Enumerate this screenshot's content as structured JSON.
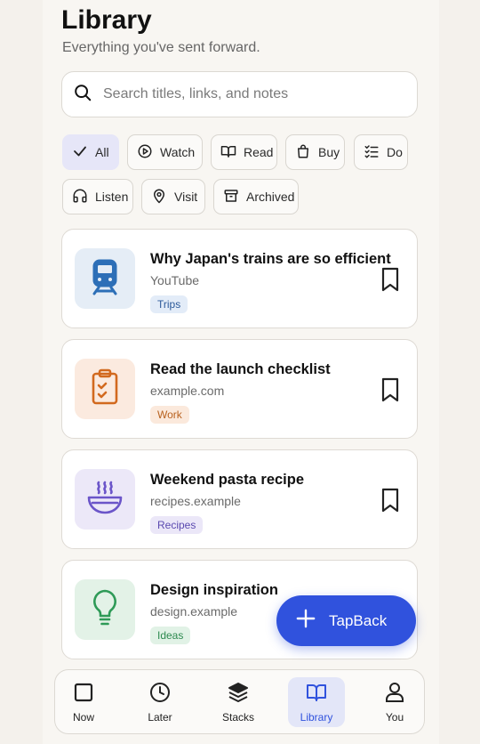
{
  "header": {
    "title": "Library",
    "subtitle": "Everything you've sent forward."
  },
  "search": {
    "placeholder": "Search titles, links, and notes",
    "icon": "search-icon"
  },
  "filters": [
    {
      "label": "All",
      "icon": "check-icon",
      "active": true
    },
    {
      "label": "Watch",
      "icon": "play-circle-icon",
      "active": false
    },
    {
      "label": "Read",
      "icon": "book-open-icon",
      "active": false
    },
    {
      "label": "Buy",
      "icon": "shopping-bag-icon",
      "active": false
    },
    {
      "label": "Do",
      "icon": "checklist-icon",
      "active": false
    },
    {
      "label": "Listen",
      "icon": "headphones-icon",
      "active": false
    },
    {
      "label": "Visit",
      "icon": "map-pin-icon",
      "active": false
    },
    {
      "label": "Archived",
      "icon": "archive-icon",
      "active": false
    }
  ],
  "items": [
    {
      "title": "Why Japan's trains are so efficient",
      "source": "YouTube",
      "tag": "Trips",
      "icon": "train-icon",
      "thumb_bg": "#e5edf6",
      "icon_color": "#2d6fb7",
      "tag_bg": "#e3ecf8",
      "tag_color": "#2d5a9a"
    },
    {
      "title": "Read the launch checklist",
      "source": "example.com",
      "tag": "Work",
      "icon": "clipboard-check-icon",
      "thumb_bg": "#fbeadf",
      "icon_color": "#d2691e",
      "tag_bg": "#fbe9dc",
      "tag_color": "#b8611f"
    },
    {
      "title": "Weekend pasta recipe",
      "source": "recipes.example",
      "tag": "Recipes",
      "icon": "bowl-steam-icon",
      "thumb_bg": "#ece8f8",
      "icon_color": "#6b55c9",
      "tag_bg": "#ebe7f8",
      "tag_color": "#5b4ab0"
    },
    {
      "title": "Design inspiration",
      "source": "design.example",
      "tag": "Ideas",
      "icon": "lightbulb-icon",
      "thumb_bg": "#e3f2e7",
      "icon_color": "#2e9a57",
      "tag_bg": "#e1f2e6",
      "tag_color": "#2e8a50"
    }
  ],
  "fab": {
    "label": "TapBack",
    "icon": "plus-icon"
  },
  "tabs": [
    {
      "label": "Now",
      "icon": "square-icon",
      "active": false
    },
    {
      "label": "Later",
      "icon": "clock-icon",
      "active": false
    },
    {
      "label": "Stacks",
      "icon": "layers-icon",
      "active": false
    },
    {
      "label": "Library",
      "icon": "book-open-icon",
      "active": true
    },
    {
      "label": "You",
      "icon": "user-icon",
      "active": false
    }
  ],
  "colors": {
    "accent": "#3052dd",
    "background": "#f4f1ec"
  }
}
